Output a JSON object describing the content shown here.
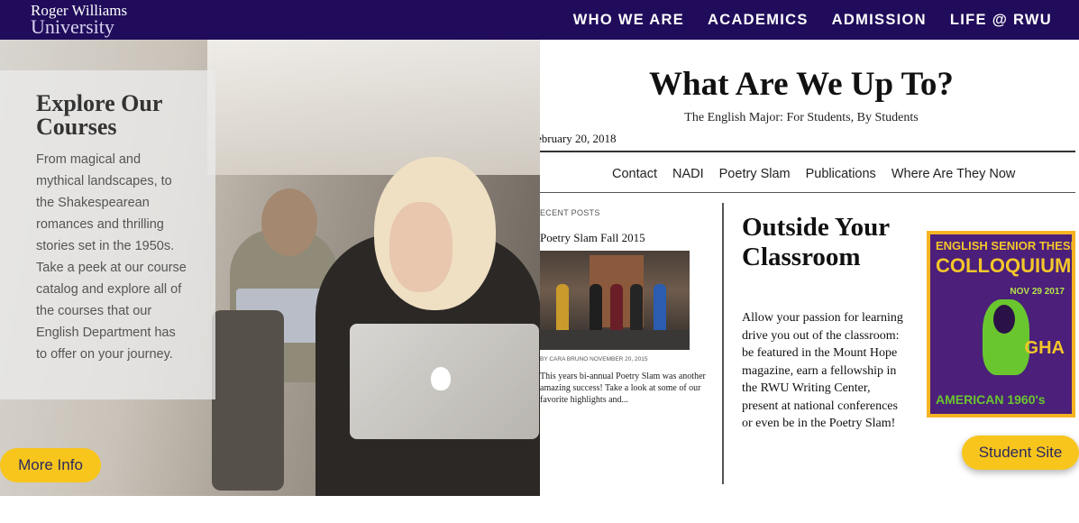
{
  "header": {
    "logo_line1": "Roger Williams",
    "logo_line2": "University",
    "nav": [
      "WHO WE ARE",
      "ACADEMICS",
      "ADMISSION",
      "LIFE @ RWU"
    ]
  },
  "left_panel": {
    "title": "Explore Our Courses",
    "body": "From magical and mythical landscapes, to the Shakespearean romances and thrilling stories set in the 1950s. Take a peek at our course catalog and explore all of the courses that our English Department has to offer on your journey.",
    "button": "More Info"
  },
  "right_panel": {
    "site_title": "What Are We Up To?",
    "tagline": "The English Major: For Students, By Students",
    "date": "ebruary 20, 2018",
    "menu": [
      "Contact",
      "NADI",
      "Poetry Slam",
      "Publications",
      "Where Are They Now"
    ],
    "recent_label": "ECENT POSTS",
    "post_title": "Poetry Slam Fall 2015",
    "post_meta": "BY CARA BRUNO NOVEMBER 20, 2015",
    "post_excerpt": "This years bi-annual Poetry Slam was another amazing success! Take a look at some of our favorite highlights and...",
    "feature_title": "Outside Your Classroom",
    "feature_text": "Allow your passion for learning drive you out of the classroom: be featured in the Mount Hope magazine, earn a fellowship in the RWU Writing Center, present at national conferences or even be in the Poetry Slam!",
    "poster_line1": "ENGLISH SENIOR THESIS",
    "poster_line2": "COLLOQUIUM",
    "poster_line3": "NOV 29 2017",
    "poster_line4": "GHA",
    "poster_line5": "AMERICAN 1960's",
    "button": "Student Site"
  },
  "colors": {
    "header_bg": "#200c5a",
    "button_bg": "#f8c51c",
    "button_text": "#2d2a5e"
  }
}
